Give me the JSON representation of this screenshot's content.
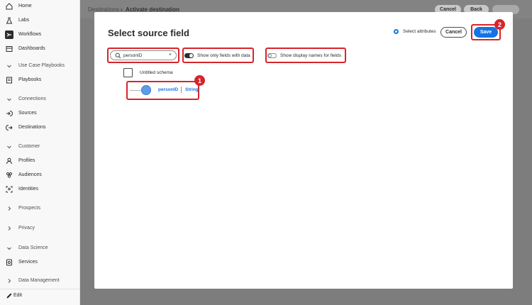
{
  "sidebar": {
    "items": [
      {
        "label": "Home",
        "icon": "home-icon",
        "type": "item"
      },
      {
        "label": "Labs",
        "icon": "flask-icon",
        "type": "item"
      },
      {
        "label": "Workflows",
        "icon": "workflow-icon",
        "type": "item",
        "active": true
      },
      {
        "label": "Dashboards",
        "icon": "dashboard-icon",
        "type": "item"
      },
      {
        "label": "Use Case Playbooks",
        "icon": "chevron-down-icon",
        "type": "section"
      },
      {
        "label": "Playbooks",
        "icon": "playbook-icon",
        "type": "item"
      },
      {
        "label": "Connections",
        "icon": "chevron-down-icon",
        "type": "section"
      },
      {
        "label": "Sources",
        "icon": "sources-icon",
        "type": "item"
      },
      {
        "label": "Destinations",
        "icon": "destinations-icon",
        "type": "item"
      },
      {
        "label": "Customer",
        "icon": "chevron-down-icon",
        "type": "section"
      },
      {
        "label": "Profiles",
        "icon": "profile-icon",
        "type": "item"
      },
      {
        "label": "Audiences",
        "icon": "audiences-icon",
        "type": "item"
      },
      {
        "label": "Identities",
        "icon": "identities-icon",
        "type": "item"
      },
      {
        "label": "Prospects",
        "icon": "chevron-right-icon",
        "type": "section"
      },
      {
        "label": "Privacy",
        "icon": "chevron-right-icon",
        "type": "section"
      },
      {
        "label": "Data Science",
        "icon": "chevron-down-icon",
        "type": "section"
      },
      {
        "label": "Services",
        "icon": "services-icon",
        "type": "item"
      },
      {
        "label": "Data Management",
        "icon": "chevron-right-icon",
        "type": "section"
      }
    ],
    "edit_label": "Edit"
  },
  "background": {
    "breadcrumb_parent": "Destinations",
    "breadcrumb_current": "Activate destination",
    "buttons": [
      "Cancel",
      "Back"
    ]
  },
  "modal": {
    "title": "Select source field",
    "radio_label": "Select attributes",
    "cancel_label": "Cancel",
    "save_label": "Save",
    "search": {
      "value": "personID",
      "clear": "×"
    },
    "toggle_data_label": "Show only fields with data",
    "toggle_display_label": "Show display names for fields",
    "toggle_data_on": true,
    "toggle_display_on": false,
    "schema_label": "Untitled schema",
    "field": {
      "name": "personID",
      "type": "String"
    }
  },
  "callouts": {
    "one": "1",
    "two": "2"
  },
  "colors": {
    "accent": "#1473e6",
    "callout": "#d7242b"
  }
}
